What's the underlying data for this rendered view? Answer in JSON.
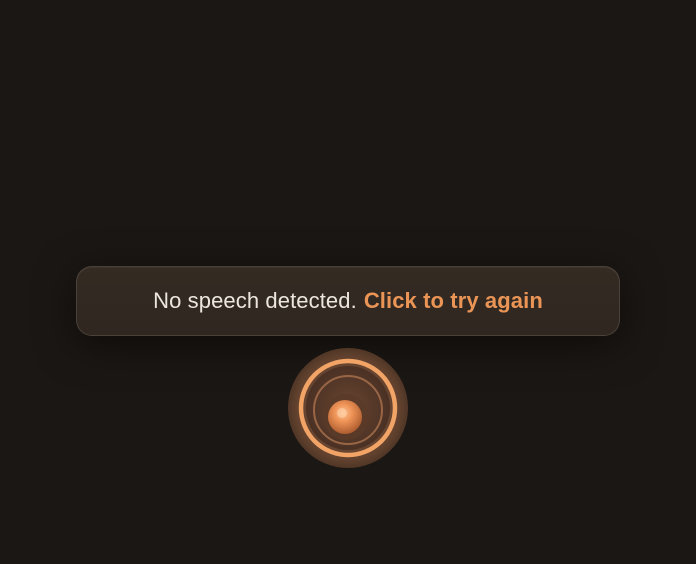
{
  "toast": {
    "message": "No speech detected.",
    "retry_label": "Click to try again"
  },
  "colors": {
    "background": "#1b1714",
    "toast_background": "#322922",
    "toast_text": "#ece6df",
    "accent": "#ea9556"
  },
  "icons": {
    "mic_orb": "voice-listening-orb-icon"
  }
}
